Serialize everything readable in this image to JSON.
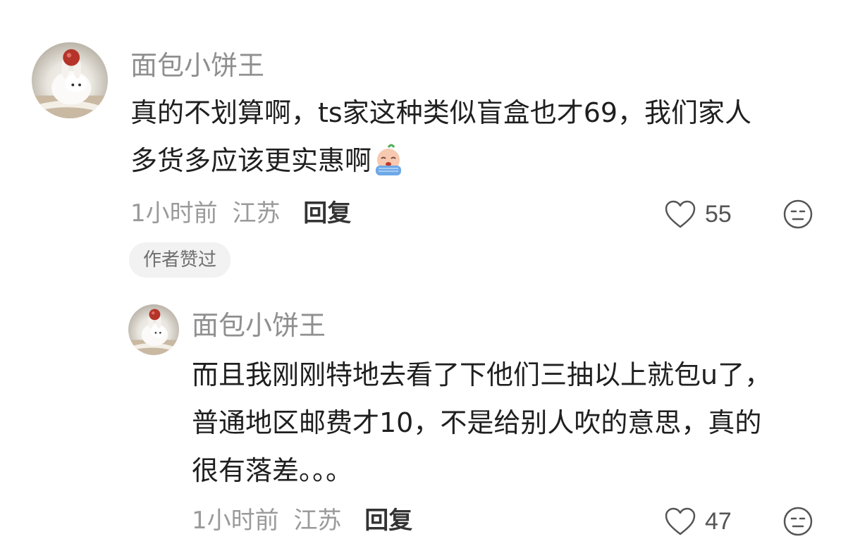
{
  "comments": [
    {
      "username": "面包小饼王",
      "lines": [
        "真的不划算啊，ts家这种类似盲盒也才69，我们家人",
        "多货多应该更实惠啊"
      ],
      "emoji": "crying-face-emoji",
      "time": "1小时前",
      "location": "江苏",
      "reply_label": "回复",
      "likes": "55",
      "badge": "作者赞过"
    },
    {
      "username": "面包小饼王",
      "lines": [
        "而且我刚刚特地去看了下他们三抽以上就包u了，",
        "普通地区邮费才10，不是给别人吹的意思，真的",
        "很有落差。。。"
      ],
      "time": "1小时前",
      "location": "江苏",
      "reply_label": "回复",
      "likes": "47"
    }
  ],
  "icons": {
    "like": "heart-outline-icon",
    "dislike": "unamused-face-icon"
  }
}
